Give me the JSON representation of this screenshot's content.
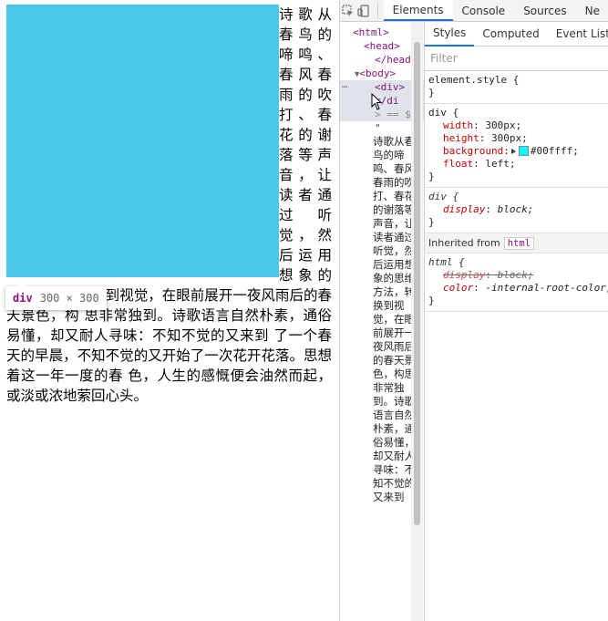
{
  "page": {
    "poem_text": "诗歌从春鸟的啼鸣、春风春雨的吹打、春花的谢落等声音，让读者通过听觉，然后运用想象的思维方法，转换到视觉，在眼前展开一夜风雨后的春天景色，构 思非常独到。诗歌语言自然朴素，通俗易懂，却又耐人寻味：不知不觉的又来到 了一个春天的早晨，不知不觉的又开始了一次花开花落。思想着这一年一度的春 色，人生的感慨便会油然而起，或淡或浓地萦回心头。",
    "box_color": "#4bc6e7"
  },
  "tooltip": {
    "tag": "div",
    "size": "300 × 300"
  },
  "devtools": {
    "tabs": [
      "Elements",
      "Console",
      "Sources",
      "Ne"
    ],
    "active_tab": "Elements",
    "elements": {
      "html_open": "<html>",
      "head_open": "<head>",
      "head_close": "</head>",
      "body_open": "<body>",
      "div_open": "<div>",
      "div_close": "</di",
      "eq_dollar": "> == $",
      "quote": "\"",
      "text_node": "诗歌从春鸟的啼鸣、春风春雨的吹打、春花的谢落等声音，让读者通过听觉，然后运用想象的思维方法，转换到视觉，在眼前展开一夜风雨后的春天景色，构思非常独到。诗歌语言自然朴素，通俗易懂，却又耐人寻味：不知不觉的又来到"
    },
    "styles": {
      "tabs": [
        "Styles",
        "Computed",
        "Event Listene"
      ],
      "active_tab": "Styles",
      "filter_placeholder": "Filter",
      "element_style_selector": "element.style {",
      "close_brace": "}",
      "div_rule": {
        "selector": "div {",
        "width_name": "width",
        "width_value": "300px;",
        "height_name": "height",
        "height_value": "300px;",
        "background_name": "background",
        "background_value": "#00ffff;",
        "background_swatch": "#00ffff",
        "float_name": "float",
        "float_value": "left;"
      },
      "div_ua_rule": {
        "selector": "div {",
        "display_name": "display",
        "display_value": "block;"
      },
      "inherited_label": "Inherited from",
      "inherited_tag": "html",
      "html_ua_rule": {
        "selector": "html {",
        "display_name": "display",
        "display_value": "block;",
        "color_name": "color",
        "color_value": "-internal-root-color;"
      }
    }
  }
}
